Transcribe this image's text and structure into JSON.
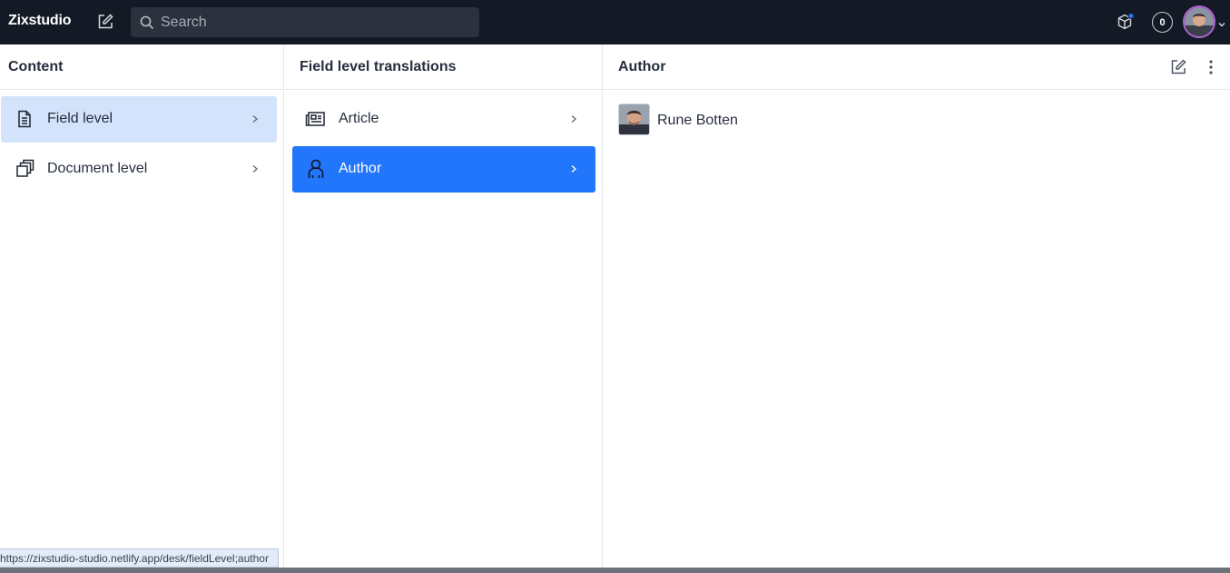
{
  "app": {
    "brand": "Zixstudio"
  },
  "topbar": {
    "search_placeholder": "Search",
    "changes_count": "0"
  },
  "pane_content": {
    "title": "Content",
    "items": [
      {
        "label": "Field level",
        "icon": "document-icon",
        "selected": true
      },
      {
        "label": "Document level",
        "icon": "documents-stack-icon",
        "selected": false
      }
    ]
  },
  "pane_translations": {
    "title": "Field level translations",
    "items": [
      {
        "label": "Article",
        "icon": "newspaper-icon",
        "selected": false
      },
      {
        "label": "Author",
        "icon": "user-icon",
        "selected": true
      }
    ]
  },
  "pane_author": {
    "title": "Author",
    "documents": [
      {
        "name": "Rune Botten"
      }
    ]
  },
  "status_bar": {
    "url": "https://zixstudio-studio.netlify.app/desk/fieldLevel;author"
  },
  "colors": {
    "topbar_bg": "#131925",
    "selected_light": "#d3e3fb",
    "selected_blue": "#2276fc",
    "avatar_ring": "#b25fd0"
  }
}
